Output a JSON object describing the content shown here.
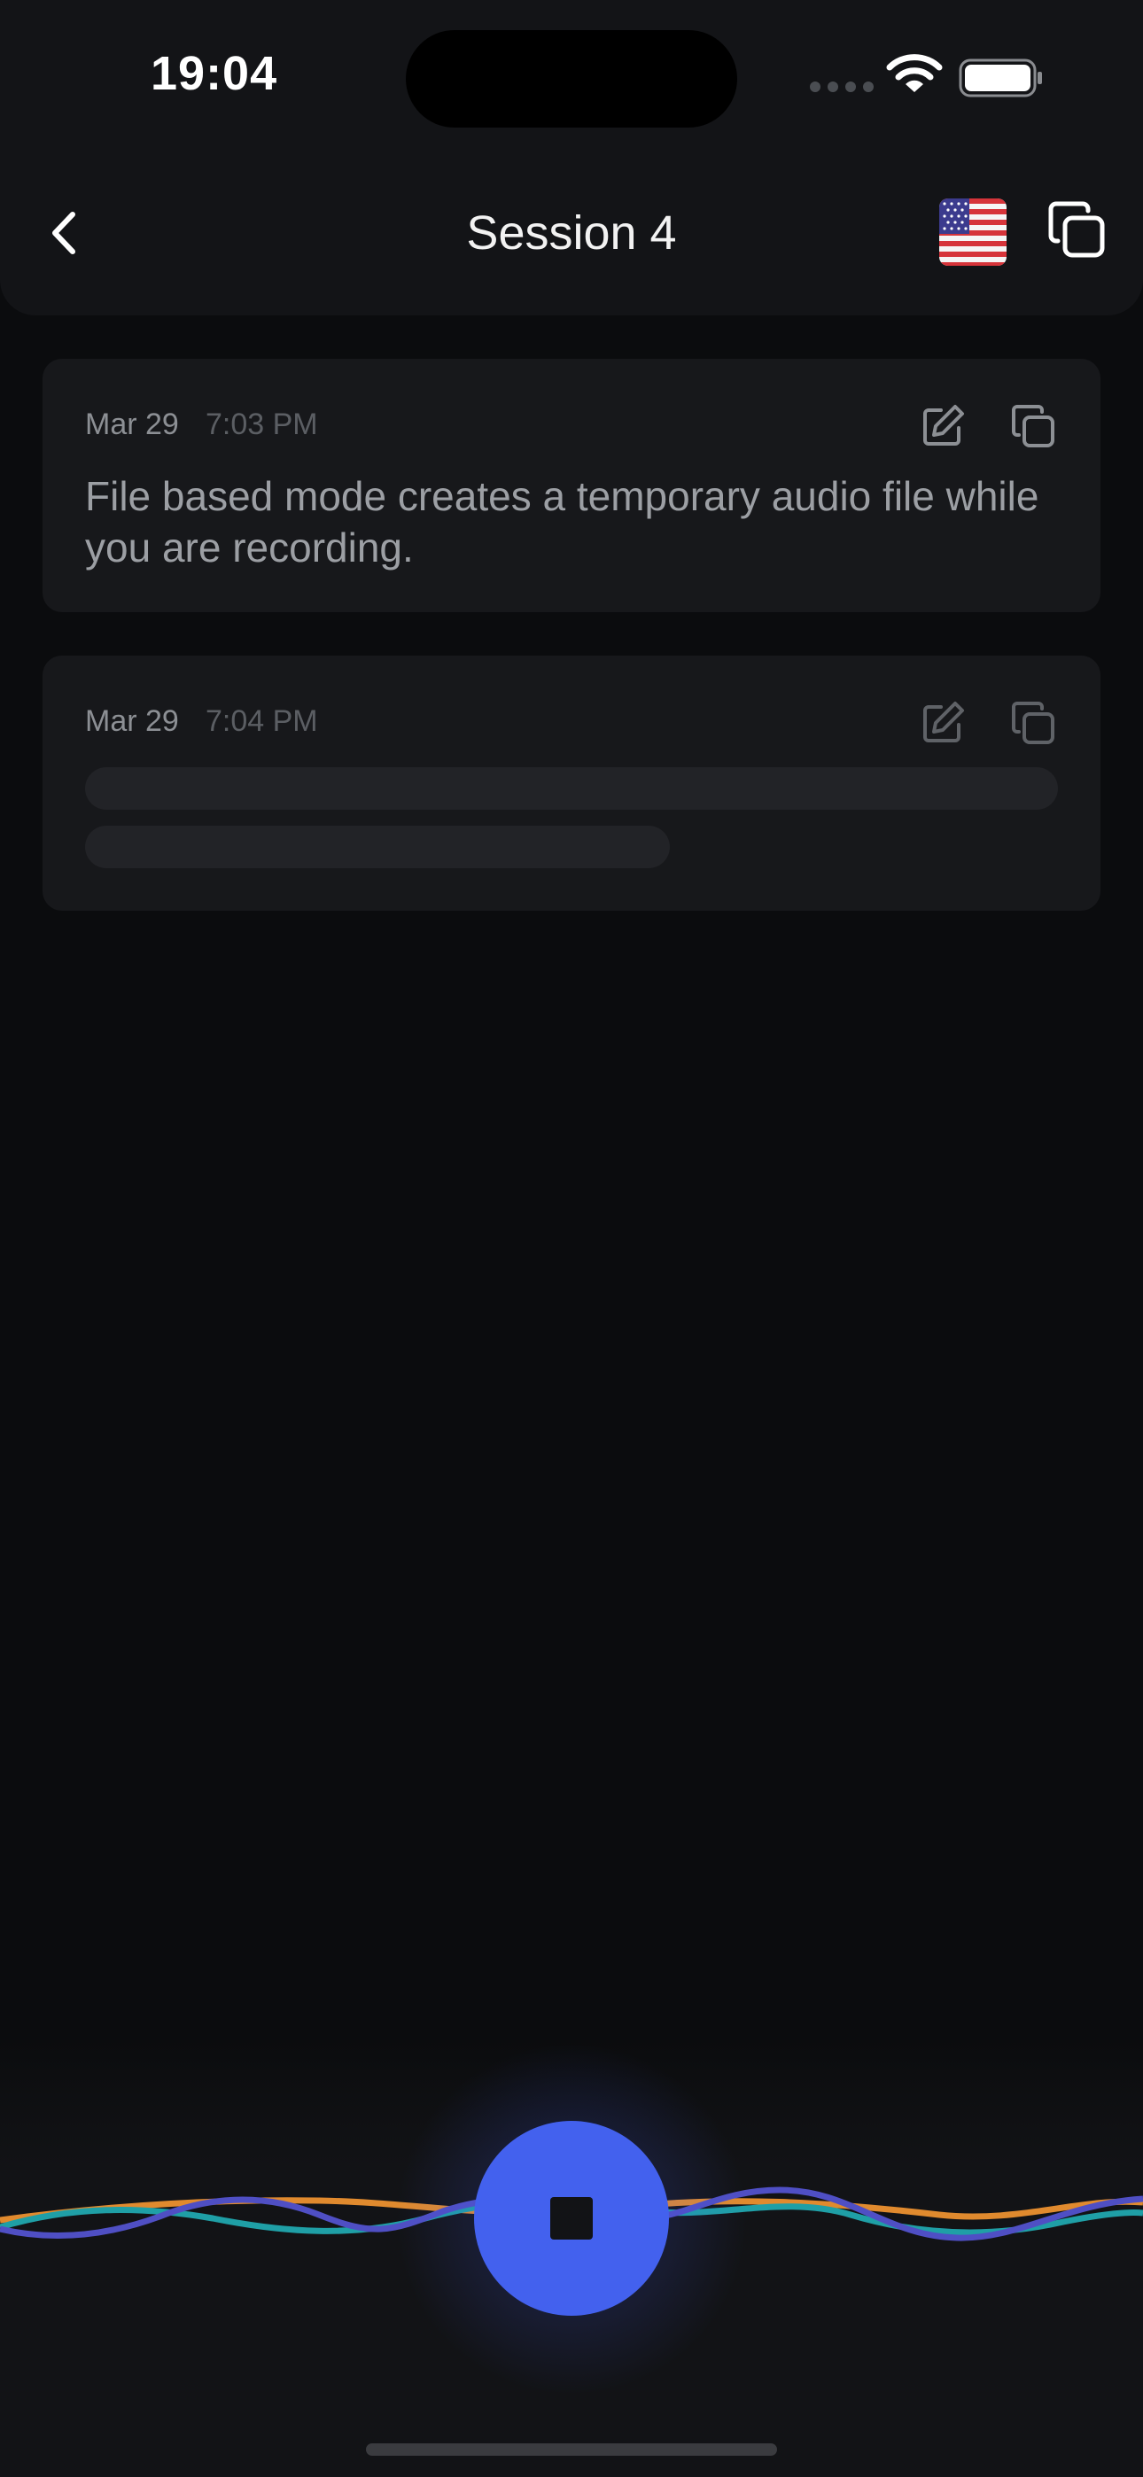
{
  "status_bar": {
    "time": "19:04"
  },
  "header": {
    "title": "Session 4",
    "language_flag": "us-flag-icon"
  },
  "transcripts": [
    {
      "date": "Mar 29",
      "time": "7:03 PM",
      "text": "File based mode creates a temporary audio file while you are recording.",
      "state": "complete"
    },
    {
      "date": "Mar 29",
      "time": "7:04 PM",
      "text": "",
      "state": "loading"
    }
  ],
  "recorder": {
    "state": "recording",
    "action": "stop"
  },
  "colors": {
    "accent": "#4361ee",
    "wave_orange": "#e08a2e",
    "wave_teal": "#1f9fa6",
    "wave_indigo": "#4f4fc4"
  }
}
